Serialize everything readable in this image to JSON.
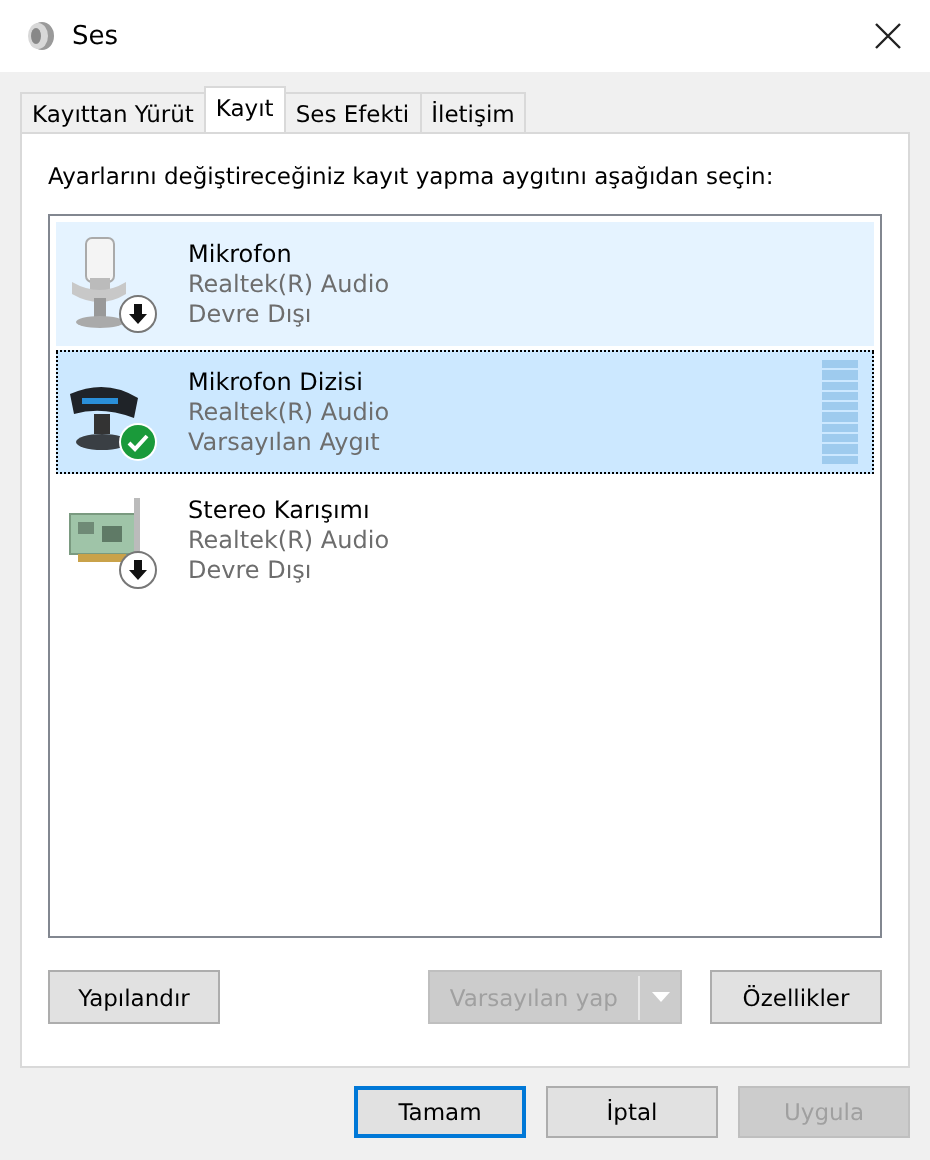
{
  "window": {
    "title": "Ses"
  },
  "tabs": [
    {
      "label": "Kayıttan Yürüt",
      "selected": false
    },
    {
      "label": "Kayıt",
      "selected": true
    },
    {
      "label": "Ses Efekti",
      "selected": false
    },
    {
      "label": "İletişim",
      "selected": false
    }
  ],
  "instruction": "Ayarlarını değiştireceğiniz kayıt yapma aygıtını aşağıdan seçin:",
  "devices": [
    {
      "kind": "microphone",
      "default": false,
      "name": "Mikrofon",
      "driver": "Realtek(R) Audio",
      "state": "Devre Dışı",
      "selected": false,
      "hovered": true
    },
    {
      "kind": "array",
      "default": true,
      "name": "Mikrofon Dizisi",
      "driver": "Realtek(R) Audio",
      "state": "Varsayılan Aygıt",
      "selected": true,
      "hovered": false
    },
    {
      "kind": "card",
      "default": false,
      "name": "Stereo Karışımı",
      "driver": "Realtek(R) Audio",
      "state": "Devre Dışı",
      "selected": false,
      "hovered": false
    }
  ],
  "panel_buttons": [
    {
      "label": "Yapılandır",
      "disabled": false,
      "split": false
    },
    {
      "label": "Varsayılan yap",
      "disabled": true,
      "split": true
    },
    {
      "label": "Özellikler",
      "disabled": false,
      "split": false
    }
  ],
  "dialog_buttons": [
    {
      "label": "Tamam",
      "disabled": false,
      "default": true
    },
    {
      "label": "İptal",
      "disabled": false,
      "default": false
    },
    {
      "label": "Uygula",
      "disabled": true,
      "default": false
    }
  ]
}
